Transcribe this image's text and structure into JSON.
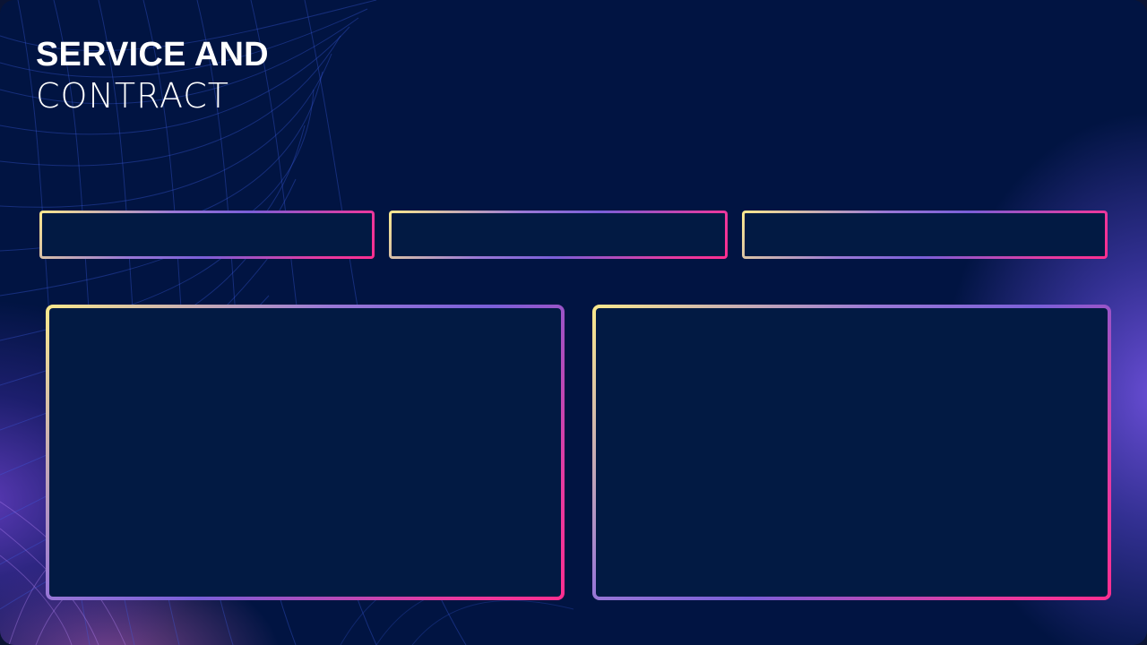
{
  "slide": {
    "title_bold": "SERVICE AND",
    "title_light": "CONTRACT"
  },
  "colors": {
    "background": "#011442",
    "panel_fill": "#021a43",
    "gradient_start": "#fbe98c",
    "gradient_mid": "#7a5fd8",
    "gradient_end": "#ff2e8f",
    "glow": "#6e50dc"
  },
  "panels": {
    "small_count": 3,
    "large_count": 2
  }
}
